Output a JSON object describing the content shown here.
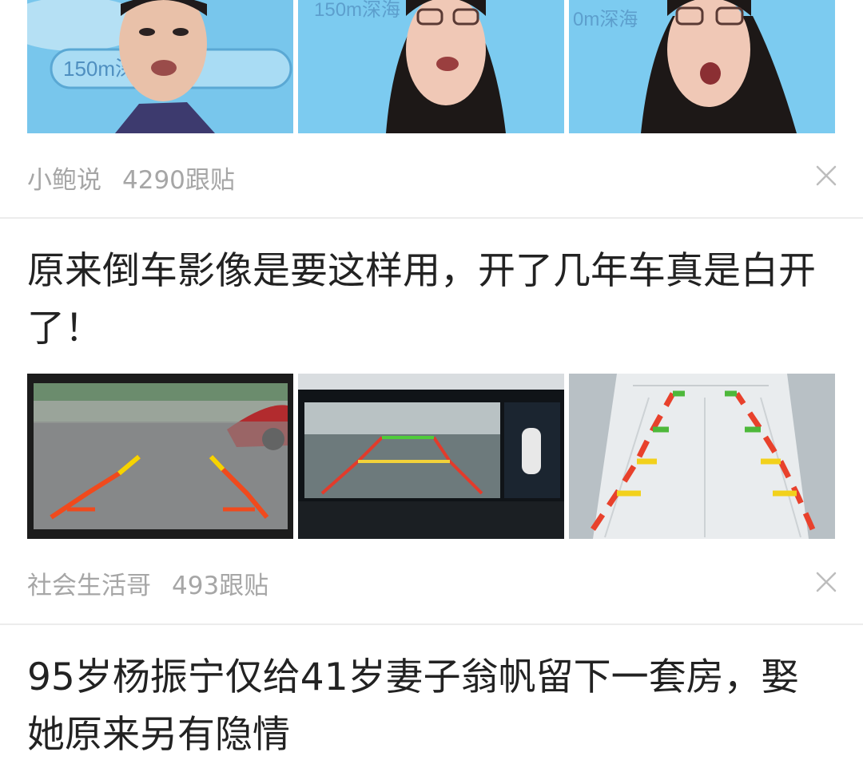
{
  "feed": [
    {
      "source": "小鲍说",
      "replies": "4290跟贴",
      "images": [
        {
          "icon": "man-speaking-thumbnail",
          "caption": "150m深海"
        },
        {
          "icon": "woman-speaking-thumbnail",
          "caption": "150m深海"
        },
        {
          "icon": "woman-surprised-thumbnail",
          "caption": "0m深海"
        }
      ]
    },
    {
      "title": "原来倒车影像是要这样用，开了几年车真是白开了！",
      "source": "社会生活哥",
      "replies": "493跟贴",
      "images": [
        {
          "icon": "reverse-camera-screen-thumbnail"
        },
        {
          "icon": "dashboard-display-thumbnail"
        },
        {
          "icon": "parking-guideline-thumbnail"
        }
      ]
    },
    {
      "title": "95岁杨振宁仅给41岁妻子翁帆留下一套房，娶她原来另有隐情"
    }
  ],
  "icons": {
    "close": "close-icon"
  },
  "colors": {
    "meta_text": "#a6a6a6",
    "divider": "#ececec",
    "title_text": "#222222"
  }
}
